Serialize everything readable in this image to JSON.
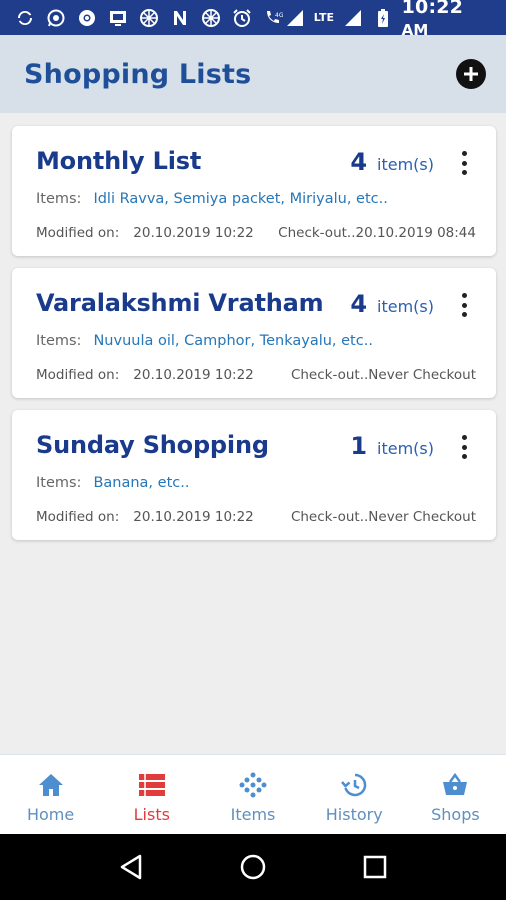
{
  "status_bar": {
    "network": "LTE",
    "time": "10:22",
    "ampm": "AM"
  },
  "header": {
    "title": "Shopping Lists"
  },
  "lists": [
    {
      "name": "Monthly List",
      "count": "4",
      "count_unit": "item(s)",
      "items_label": "Items:",
      "items_value": "Idli Ravva, Semiya packet, Miriyalu, etc..",
      "modified_label": "Modified on:",
      "modified_date": "20.10.2019 10:22",
      "checkout": "Check-out..20.10.2019 08:44"
    },
    {
      "name": "Varalakshmi Vratham",
      "count": "4",
      "count_unit": "item(s)",
      "items_label": "Items:",
      "items_value": "Nuvuula oil, Camphor, Tenkayalu, etc..",
      "modified_label": "Modified on:",
      "modified_date": "20.10.2019 10:22",
      "checkout": "Check-out..Never Checkout"
    },
    {
      "name": "Sunday Shopping",
      "count": "1",
      "count_unit": "item(s)",
      "items_label": "Items:",
      "items_value": "Banana, etc..",
      "modified_label": "Modified on:",
      "modified_date": "20.10.2019 10:22",
      "checkout": "Check-out..Never Checkout"
    }
  ],
  "bottom_nav": {
    "items": [
      {
        "label": "Home",
        "icon": "home-icon"
      },
      {
        "label": "Lists",
        "icon": "lists-icon",
        "active": true
      },
      {
        "label": "Items",
        "icon": "items-icon"
      },
      {
        "label": "History",
        "icon": "history-icon"
      },
      {
        "label": "Shops",
        "icon": "basket-icon"
      }
    ]
  },
  "colors": {
    "status_bar": "#1f3d8a",
    "app_bar": "#d7dfe8",
    "title": "#1a3b8c",
    "link": "#2676b8",
    "nav_inactive": "#5f8fbf",
    "nav_active": "#e23b3b"
  }
}
